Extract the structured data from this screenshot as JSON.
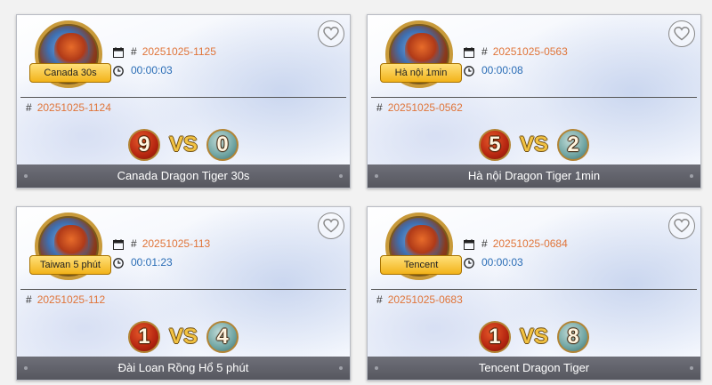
{
  "cards": [
    {
      "badge": "Canada 30s",
      "current_issue": "20251025-1125",
      "countdown": "00:00:03",
      "previous_issue": "20251025-1124",
      "dragon_score": "9",
      "vs": "VS",
      "tiger_score": "0",
      "title": "Canada Dragon Tiger 30s"
    },
    {
      "badge": "Hà nội 1min",
      "current_issue": "20251025-0563",
      "countdown": "00:00:08",
      "previous_issue": "20251025-0562",
      "dragon_score": "5",
      "vs": "VS",
      "tiger_score": "2",
      "title": "Hà nội Dragon Tiger 1min"
    },
    {
      "badge": "Taiwan 5 phút",
      "current_issue": "20251025-113",
      "countdown": "00:01:23",
      "previous_issue": "20251025-112",
      "dragon_score": "1",
      "vs": "VS",
      "tiger_score": "4",
      "title": "Đài Loan Rồng Hổ 5 phút"
    },
    {
      "badge": "Tencent",
      "current_issue": "20251025-0684",
      "countdown": "00:00:03",
      "previous_issue": "20251025-0683",
      "dragon_score": "1",
      "vs": "VS",
      "tiger_score": "8",
      "title": "Tencent Dragon Tiger"
    }
  ],
  "labels": {
    "hash": "#"
  },
  "icons": {
    "favorite": "heart-outline-icon",
    "calendar": "calendar-icon",
    "clock": "clock-icon"
  },
  "colors": {
    "issue_number": "#e0753a",
    "countdown": "#2a6db6",
    "footer_bg": "#5f6068",
    "vs_gold": "#f2c242"
  }
}
